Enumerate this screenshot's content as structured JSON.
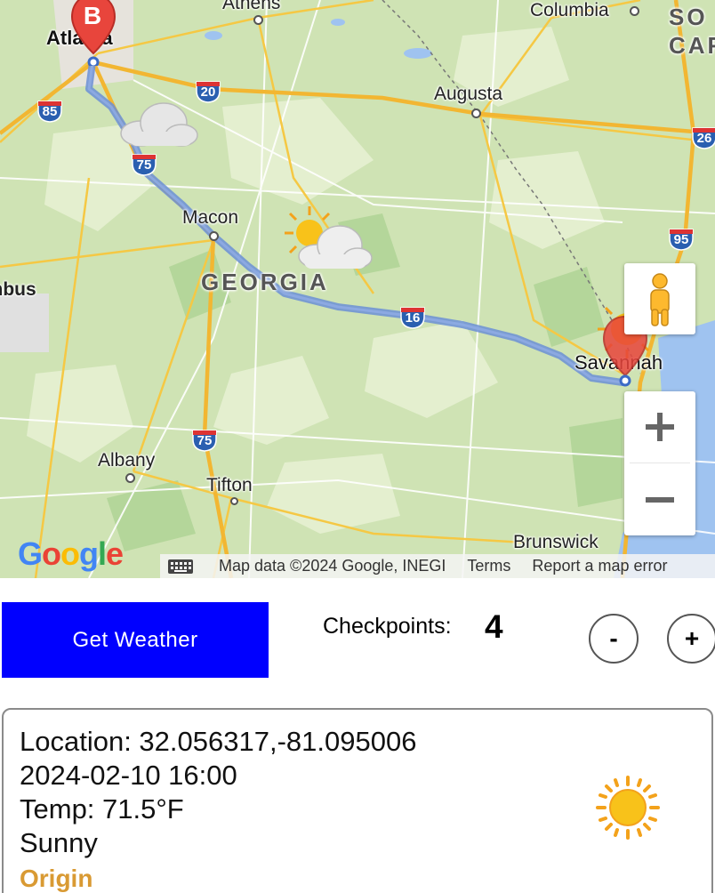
{
  "map": {
    "cities": {
      "atlanta": "Atlanta",
      "athens": "Athens",
      "columbia": "Columbia",
      "augusta": "Augusta",
      "macon": "Macon",
      "columbus": "Columbus",
      "savannah": "Savannah",
      "albany": "Albany",
      "tifton": "Tifton",
      "brunswick": "Brunswick"
    },
    "state_labels": {
      "georgia": "GEORGIA",
      "south_carolina_top": "SO",
      "south_carolina_bottom": "CARO"
    },
    "highways": [
      "85",
      "20",
      "75",
      "16",
      "95",
      "75",
      "26"
    ],
    "marker_b": "B",
    "attribution": {
      "map_data": "Map data ©2024 Google, INEGI",
      "terms": "Terms",
      "report": "Report a map error"
    },
    "logo_text": "Google",
    "colors": {
      "route": "#6b8fd6",
      "marker": "#e8453c",
      "land": "#cfe3b4",
      "water": "#9fc3f0"
    }
  },
  "controls": {
    "get_weather_label": "Get Weather",
    "checkpoints_label": "Checkpoints:",
    "checkpoints_count": "4",
    "minus_label": "-",
    "plus_label": "+"
  },
  "weather_card": {
    "location": "Location: 32.056317,-81.095006",
    "datetime": "2024-02-10 16:00",
    "temp": "Temp: 71.5°F",
    "condition": "Sunny",
    "tag": "Origin",
    "icon": "sun-icon"
  }
}
